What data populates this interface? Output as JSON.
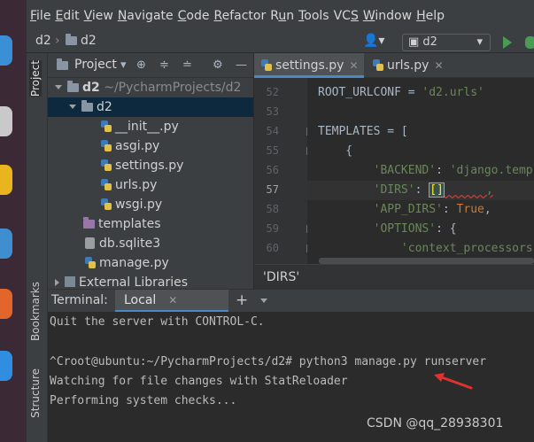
{
  "menu": [
    {
      "pre": "",
      "u": "F",
      "post": "ile"
    },
    {
      "pre": "",
      "u": "E",
      "post": "dit"
    },
    {
      "pre": "",
      "u": "V",
      "post": "iew"
    },
    {
      "pre": "",
      "u": "N",
      "post": "avigate"
    },
    {
      "pre": "",
      "u": "C",
      "post": "ode"
    },
    {
      "pre": "",
      "u": "R",
      "post": "efactor"
    },
    {
      "pre": "R",
      "u": "u",
      "post": "n"
    },
    {
      "pre": "",
      "u": "T",
      "post": "ools"
    },
    {
      "pre": "VC",
      "u": "S",
      "post": ""
    },
    {
      "pre": "",
      "u": "W",
      "post": "indow"
    },
    {
      "pre": "",
      "u": "H",
      "post": "elp"
    }
  ],
  "nav": {
    "project": "d2",
    "folder": "d2",
    "run_config": "d2"
  },
  "left_strip": {
    "project_tab": "Project",
    "bookmarks_tab": "Bookmarks",
    "structure_tab": "Structure"
  },
  "project_panel": {
    "title": "Project",
    "root_name": "d2",
    "root_path": "~/PycharmProjects/d2",
    "pkg": "d2",
    "files": [
      "__init__.py",
      "asgi.py",
      "settings.py",
      "urls.py",
      "wsgi.py"
    ],
    "templates": "templates",
    "db": "db.sqlite3",
    "manage": "manage.py",
    "external": "External Libraries"
  },
  "editor": {
    "tabs": [
      "settings.py",
      "urls.py"
    ],
    "lines": [
      "52",
      "53",
      "54",
      "55",
      "56",
      "57",
      "58",
      "59",
      "60"
    ],
    "code": {
      "l52a": "ROOT_URLCONF = ",
      "l52b": "'d2.urls'",
      "l54": "TEMPLATES = [",
      "l55": "    {",
      "l56a": "        'BACKEND'",
      "l56b": ": ",
      "l56c": "'django.temp",
      "l57a": "        'DIRS'",
      "l57b": ": ",
      "l57c": "[]",
      "l57d": "      ,",
      "l58a": "        'APP_DIRS'",
      "l58b": ": ",
      "l58c": "True",
      "l58d": ",",
      "l59a": "        'OPTIONS'",
      "l59b": ": {",
      "l60": "            'context_processors"
    },
    "breadcrumb": "'DIRS'"
  },
  "terminal": {
    "label": "Terminal:",
    "tab": "Local",
    "lines": [
      "Quit the server with CONTROL-C.",
      "",
      "^Croot@ubuntu:~/PycharmProjects/d2# python3 manage.py runserver",
      "Watching for file changes with StatReloader",
      "Performing system checks..."
    ]
  },
  "watermark": "CSDN @qq_28938301",
  "colors": {
    "accent": "#4a88c7",
    "annotation_arrow": "#e0322c"
  }
}
